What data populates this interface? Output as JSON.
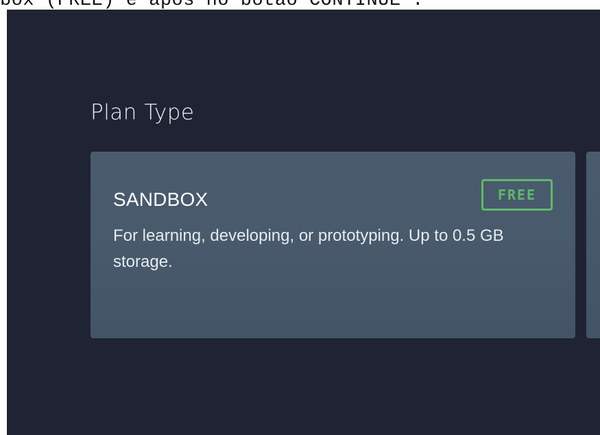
{
  "caption": {
    "text": "box (FREE) e após no botão  CONTINUE\"."
  },
  "section": {
    "title": "Plan Type"
  },
  "plans": [
    {
      "name": "SANDBOX",
      "badge": "FREE",
      "description": "For learning, developing, or prototyping. Up to 0.5 GB storage."
    }
  ],
  "colors": {
    "panel_background": "#1f2333",
    "card_background": "#485a6b",
    "badge_accent": "#5fb96b",
    "title_text": "#eef1f5"
  }
}
